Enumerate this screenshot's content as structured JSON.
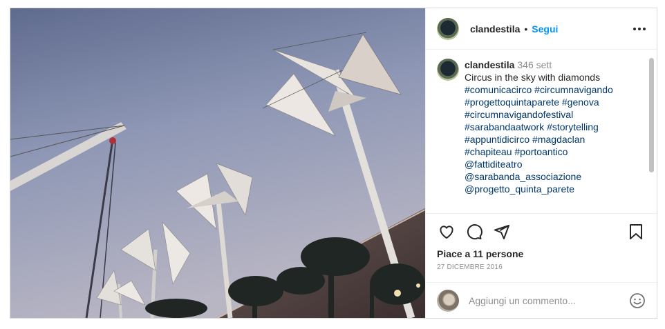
{
  "header": {
    "username": "clandestila",
    "separator": "•",
    "follow_label": "Segui"
  },
  "caption": {
    "username": "clandestila",
    "time": "346 sett",
    "text": "Circus in the sky with diamonds",
    "tags": [
      "#comunicacirco #circumnavigando",
      "#progettoquintaparete #genova",
      "#circumnavigandofestival",
      "#sarabandaatwork #storytelling",
      "#appuntidicirco #magdaclan",
      "#chapiteau #portoantico",
      "@fattiditeatro",
      "@sarabanda_associazione",
      "@progetto_quinta_parete"
    ]
  },
  "actions": {
    "likes": "Piace a 11 persone",
    "date": "27 dicembre 2016"
  },
  "comment_box": {
    "placeholder": "Aggiungi un commento..."
  }
}
